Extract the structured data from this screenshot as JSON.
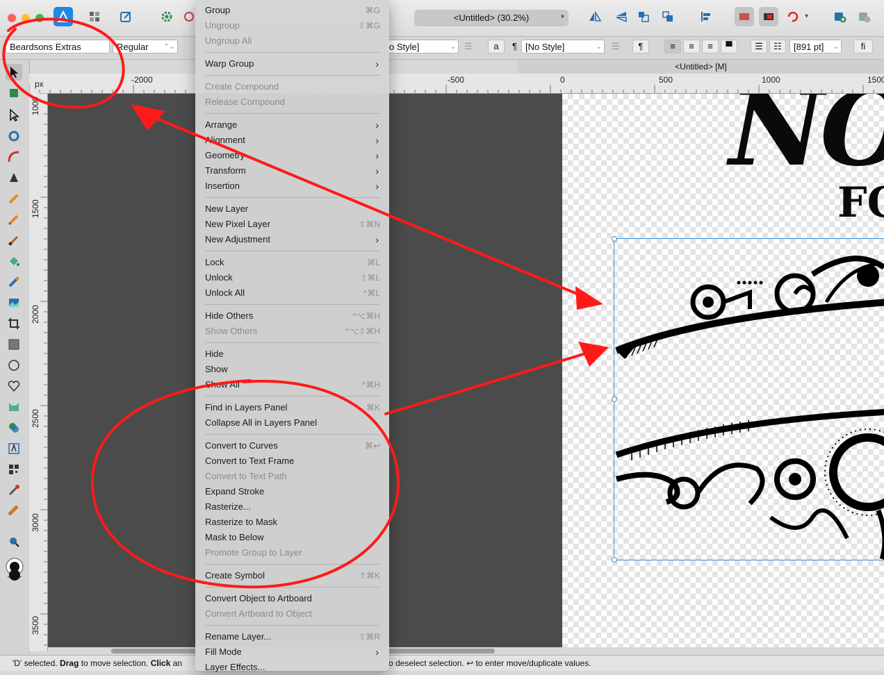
{
  "app": {
    "document_title": "<Untitled> (30.2%)",
    "document_modified_mark": "*",
    "tab_label": "<Untitled> [M]"
  },
  "context_toolbar": {
    "font_family": "Beardsons Extras",
    "font_style": "Regular",
    "char_style": "o Style]",
    "para_style": "[No Style]",
    "pilcrow": "¶",
    "case_button": "a",
    "font_size": "[891 pt]",
    "ligature_button": "fi"
  },
  "rulers": {
    "unit": "px",
    "horizontal": [
      "-2000",
      "-500",
      "0",
      "500",
      "1000",
      "1500"
    ],
    "vertical": [
      "1000",
      "1500",
      "2000",
      "2500",
      "3000",
      "3500"
    ]
  },
  "artboard_text": {
    "heading": "NO",
    "subheading": "FO"
  },
  "menu": {
    "items": [
      {
        "label": "Group",
        "shortcut": "⌘G",
        "enabled": true
      },
      {
        "label": "Ungroup",
        "shortcut": "⇧⌘G",
        "enabled": false
      },
      {
        "label": "Ungroup All",
        "shortcut": "",
        "enabled": false
      },
      {
        "label": "Warp Group",
        "submenu": true,
        "enabled": true
      },
      {
        "label": "Create Compound",
        "shortcut": "",
        "enabled": false
      },
      {
        "label": "Release Compound",
        "shortcut": "",
        "enabled": false
      },
      {
        "label": "Arrange",
        "submenu": true,
        "enabled": true
      },
      {
        "label": "Alignment",
        "submenu": true,
        "enabled": true
      },
      {
        "label": "Geometry",
        "submenu": true,
        "enabled": true
      },
      {
        "label": "Transform",
        "submenu": true,
        "enabled": true
      },
      {
        "label": "Insertion",
        "submenu": true,
        "enabled": true
      },
      {
        "label": "New Layer",
        "shortcut": "",
        "enabled": true
      },
      {
        "label": "New Pixel Layer",
        "shortcut": "⇧⌘N",
        "enabled": true
      },
      {
        "label": "New Adjustment",
        "submenu": true,
        "enabled": true
      },
      {
        "label": "Lock",
        "shortcut": "⌘L",
        "enabled": true
      },
      {
        "label": "Unlock",
        "shortcut": "⇧⌘L",
        "enabled": true
      },
      {
        "label": "Unlock All",
        "shortcut": "^⌘L",
        "enabled": true
      },
      {
        "label": "Hide Others",
        "shortcut": "^⌥⌘H",
        "enabled": true
      },
      {
        "label": "Show Others",
        "shortcut": "^⌥⇧⌘H",
        "enabled": false
      },
      {
        "label": "Hide",
        "shortcut": "",
        "enabled": true
      },
      {
        "label": "Show",
        "shortcut": "",
        "enabled": true
      },
      {
        "label": "Show All",
        "shortcut": "^⌘H",
        "enabled": true
      },
      {
        "label": "Find in Layers Panel",
        "shortcut": "⌘K",
        "enabled": true
      },
      {
        "label": "Collapse All in Layers Panel",
        "shortcut": "",
        "enabled": true
      },
      {
        "label": "Convert to Curves",
        "shortcut": "⌘↩",
        "enabled": true
      },
      {
        "label": "Convert to Text Frame",
        "shortcut": "",
        "enabled": true
      },
      {
        "label": "Convert to Text Path",
        "shortcut": "",
        "enabled": false
      },
      {
        "label": "Expand Stroke",
        "shortcut": "",
        "enabled": true
      },
      {
        "label": "Rasterize...",
        "shortcut": "",
        "enabled": true
      },
      {
        "label": "Rasterize to Mask",
        "shortcut": "",
        "enabled": true
      },
      {
        "label": "Mask to Below",
        "shortcut": "",
        "enabled": true
      },
      {
        "label": "Promote Group to Layer",
        "shortcut": "",
        "enabled": false
      },
      {
        "label": "Create Symbol",
        "shortcut": "⇧⌘K",
        "enabled": true
      },
      {
        "label": "Convert Object to Artboard",
        "shortcut": "",
        "enabled": true
      },
      {
        "label": "Convert Artboard to Object",
        "shortcut": "",
        "enabled": false
      },
      {
        "label": "Rename Layer...",
        "shortcut": "⇧⌘R",
        "enabled": true
      },
      {
        "label": "Fill Mode",
        "submenu": true,
        "enabled": true
      },
      {
        "label": "Layer Effects...",
        "shortcut": "",
        "enabled": true
      }
    ]
  },
  "status": {
    "part1": "'D' selected. ",
    "drag": "Drag",
    "part2": " to move selection. ",
    "click": "Click",
    "part3": " an",
    "part4": "o deselect selection. ↩ to enter move/duplicate values."
  },
  "colors": {
    "annotation": "#ff1a1a",
    "selection": "#3b8fd6",
    "pasteboard": "#4b4b4b",
    "app_accent": "#1e88e5"
  }
}
